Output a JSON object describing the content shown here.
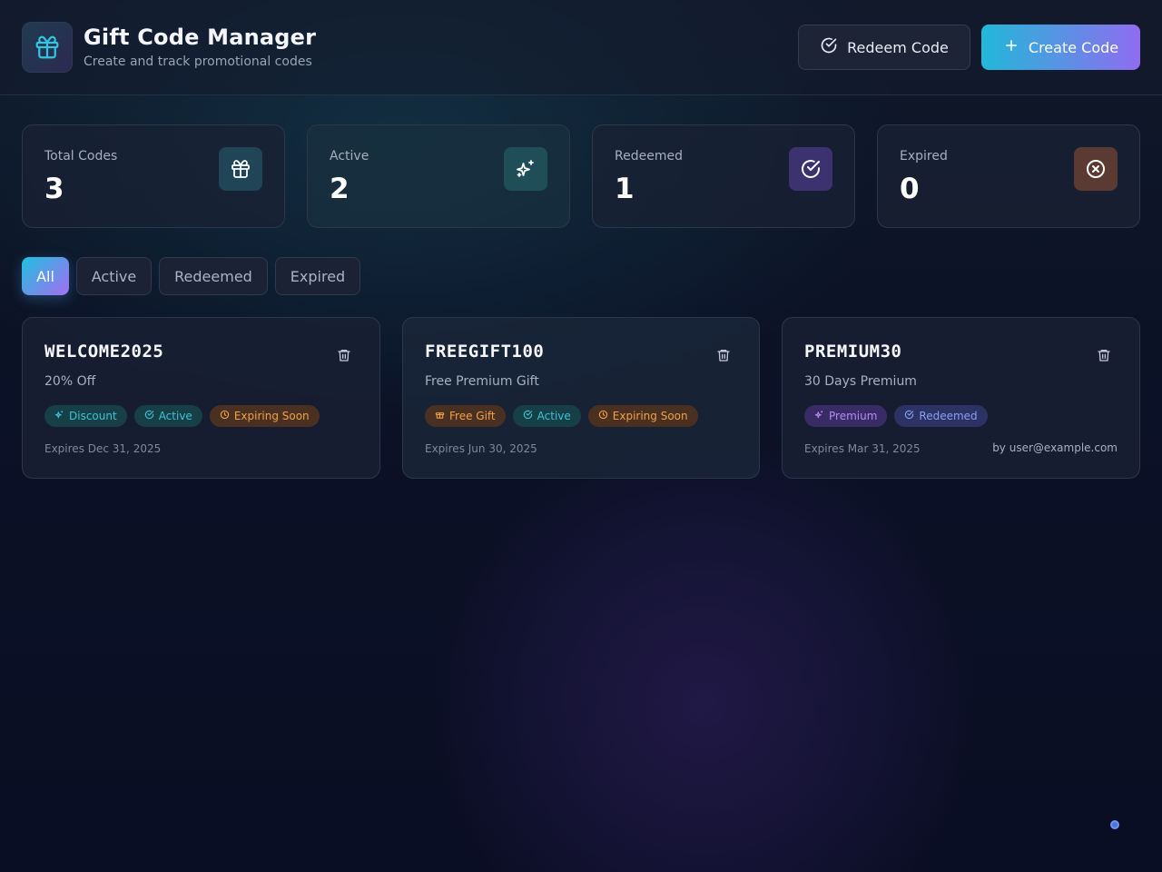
{
  "header": {
    "title": "Gift Code Manager",
    "subtitle": "Create and track promotional codes",
    "logo_icon": "gift-icon",
    "redeem_label": "Redeem Code",
    "create_label": "Create Code"
  },
  "stats": [
    {
      "label": "Total Codes",
      "value": "3",
      "icon": "gift-icon"
    },
    {
      "label": "Active",
      "value": "2",
      "icon": "sparkles-icon"
    },
    {
      "label": "Redeemed",
      "value": "1",
      "icon": "check-circle-icon"
    },
    {
      "label": "Expired",
      "value": "0",
      "icon": "x-circle-icon"
    }
  ],
  "filters": {
    "tabs": [
      "All",
      "Active",
      "Redeemed",
      "Expired"
    ],
    "selected": "All"
  },
  "codes": [
    {
      "code": "WELCOME2025",
      "description": "20% Off",
      "badges": [
        "Discount",
        "Active",
        "Expiring Soon"
      ],
      "expires": "Expires Dec 31, 2025",
      "redeemed_by": ""
    },
    {
      "code": "FREEGIFT100",
      "description": "Free Premium Gift",
      "badges": [
        "Free Gift",
        "Active",
        "Expiring Soon"
      ],
      "expires": "Expires Jun 30, 2025",
      "redeemed_by": ""
    },
    {
      "code": "PREMIUM30",
      "description": "30 Days Premium",
      "badges": [
        "Premium",
        "Redeemed"
      ],
      "expires": "Expires Mar 31, 2025",
      "redeemed_by": "by user@example.com"
    }
  ],
  "colors": {
    "accent_start": "#22b8d8",
    "accent_end": "#8f6cf0",
    "teal": "#3fc4d4",
    "orange": "#f0a24a",
    "purple": "#b58cf4",
    "indigo": "#8c9ef0"
  }
}
